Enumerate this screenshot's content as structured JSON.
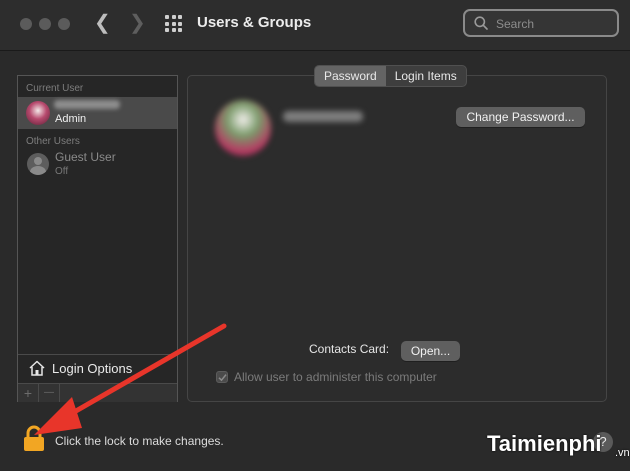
{
  "window": {
    "title": "Users & Groups",
    "search_placeholder": "Search"
  },
  "sidebar": {
    "current_user_label": "Current User",
    "current_user_role": "Admin",
    "other_users_label": "Other Users",
    "guest_name": "Guest User",
    "guest_status": "Off",
    "login_options_label": "Login Options",
    "add_label": "+",
    "remove_label": "—"
  },
  "main": {
    "tabs": [
      "Password",
      "Login Items"
    ],
    "active_tab": "Password",
    "change_password_label": "Change Password...",
    "contacts_card_label": "Contacts Card:",
    "open_label": "Open...",
    "allow_admin_label": "Allow user to administer this computer",
    "allow_admin_checked": true
  },
  "footer": {
    "lock_text": "Click the lock to make changes.",
    "help_label": "?"
  },
  "overlay": {
    "arrow_color": "#e8352a",
    "watermark_text": "Taimienphi",
    "watermark_suffix": ".vn"
  },
  "colors": {
    "window_bg": "#2a2a2a",
    "selected_row": "#4a4a4a",
    "lock_color": "#f2a623"
  }
}
